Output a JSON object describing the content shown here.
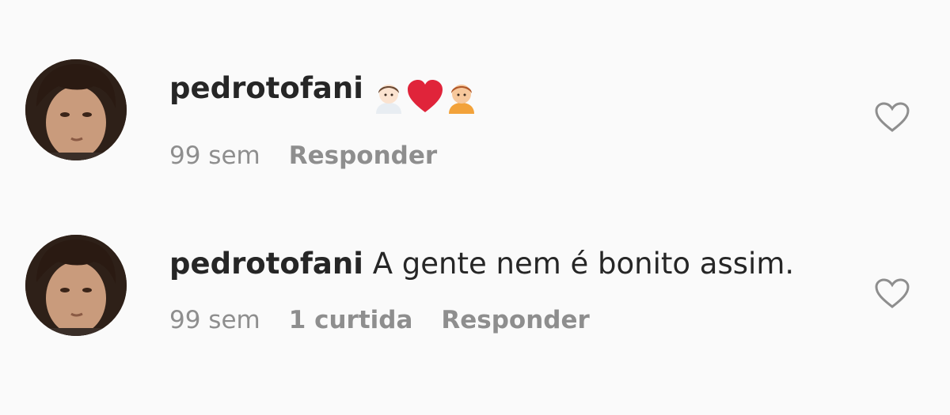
{
  "comments": [
    {
      "username": "pedrotofani",
      "text": "",
      "emojis": [
        "boy-emoji",
        "red-heart-emoji",
        "boy-emoji"
      ],
      "time": "99 sem",
      "likes": "",
      "reply_label": "Responder",
      "like_icon": "heart-outline-icon"
    },
    {
      "username": "pedrotofani",
      "text": "A gente nem é bonito assim.",
      "emojis": [],
      "time": "99 sem",
      "likes": "1 curtida",
      "reply_label": "Responder",
      "like_icon": "heart-outline-icon"
    }
  ],
  "colors": {
    "background": "#fafafa",
    "primary_text": "#262626",
    "secondary_text": "#8e8e8e",
    "heart_emoji": "#e0243a"
  }
}
